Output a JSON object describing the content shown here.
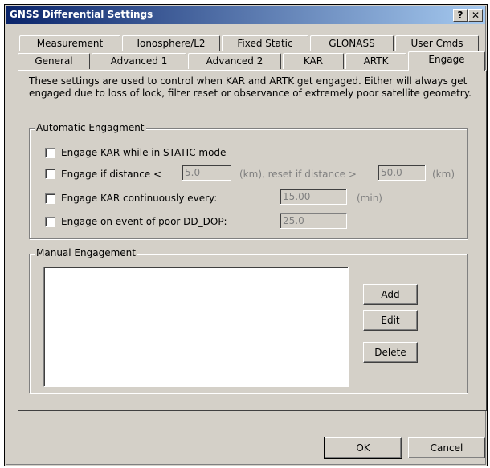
{
  "window": {
    "title": "GNSS Differential Settings"
  },
  "titlebar": {
    "help": "?",
    "close": "✕"
  },
  "tabs_row1": [
    "Measurement",
    "Ionosphere/L2",
    "Fixed Static",
    "GLONASS",
    "User Cmds"
  ],
  "tabs_row2": [
    "General",
    "Advanced 1",
    "Advanced 2",
    "KAR",
    "ARTK",
    "Engage"
  ],
  "active_tab": "Engage",
  "description": "These settings are used to control when KAR and ARTK get engaged.  Either will always get engaged due to loss of lock, filter reset or observance of extremely poor satellite geometry.",
  "auto": {
    "title": "Automatic Engagment",
    "static_label": "Engage KAR while in STATIC mode",
    "distance_label": "Engage if distance <",
    "distance_value": "5.0",
    "distance_unit_reset": "(km), reset if distance >",
    "reset_value": "50.0",
    "reset_unit": "(km)",
    "continuous_label": "Engage KAR continuously every:",
    "continuous_value": "15.00",
    "continuous_unit": "(min)",
    "dop_label": "Engage on event of poor DD_DOP:",
    "dop_value": "25.0"
  },
  "manual": {
    "title": "Manual Engagement",
    "add": "Add",
    "edit": "Edit",
    "delete": "Delete"
  },
  "footer": {
    "ok": "OK",
    "cancel": "Cancel"
  },
  "colors": {
    "face": "#d4d0c8",
    "title_start": "#0a246a",
    "title_end": "#a6caf0"
  }
}
